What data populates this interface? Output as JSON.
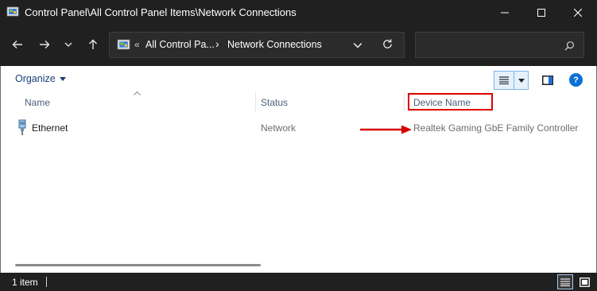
{
  "window": {
    "title": "Control Panel\\All Control Panel Items\\Network Connections",
    "minimize_glyph": "—",
    "maximize_glyph": "☐",
    "close_glyph": "✕"
  },
  "address": {
    "overflow": "«",
    "crumb1": "All Control Pa...",
    "sep": "›",
    "crumb2": "Network Connections",
    "dropdown_glyph": "⌄",
    "refresh_glyph": "↻"
  },
  "search": {
    "placeholder": ""
  },
  "toolbar": {
    "organize": "Organize",
    "help": "?"
  },
  "columns": {
    "name": "Name",
    "status": "Status",
    "device": "Device Name"
  },
  "rows": [
    {
      "name": "Ethernet",
      "status": "Network",
      "device": "Realtek Gaming GbE Family Controller"
    }
  ],
  "statusbar": {
    "count": "1 item"
  },
  "colors": {
    "highlight": "#e10000",
    "arrow": "#d40000",
    "accent_blue": "#0a6fd6"
  }
}
